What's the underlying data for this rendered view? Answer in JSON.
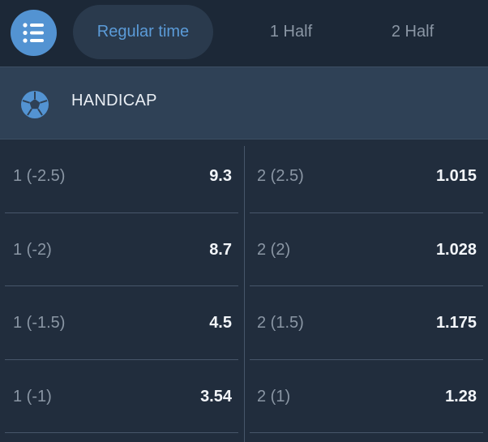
{
  "tabs": [
    {
      "label": "Regular time",
      "active": true
    },
    {
      "label": "1 Half",
      "active": false
    },
    {
      "label": "2 Half",
      "active": false
    }
  ],
  "menu_icon": "list-icon",
  "section": {
    "icon": "soccer-ball-icon",
    "title": "HANDICAP"
  },
  "rows": [
    {
      "left": {
        "label": "1 (-2.5)",
        "odds": "9.3"
      },
      "right": {
        "label": "2 (2.5)",
        "odds": "1.015"
      }
    },
    {
      "left": {
        "label": "1 (-2)",
        "odds": "8.7"
      },
      "right": {
        "label": "2 (2)",
        "odds": "1.028"
      }
    },
    {
      "left": {
        "label": "1 (-1.5)",
        "odds": "4.5"
      },
      "right": {
        "label": "2 (1.5)",
        "odds": "1.175"
      }
    },
    {
      "left": {
        "label": "1 (-1)",
        "odds": "3.54"
      },
      "right": {
        "label": "2 (1)",
        "odds": "1.28"
      }
    }
  ],
  "colors": {
    "background": "#212d3d",
    "topbar": "#1c2837",
    "header": "#2f4156",
    "accent": "#5393d2",
    "active_tab_text": "#5b9bd8",
    "muted_text": "#8a96a4",
    "odds_text": "#f2f5f9"
  }
}
